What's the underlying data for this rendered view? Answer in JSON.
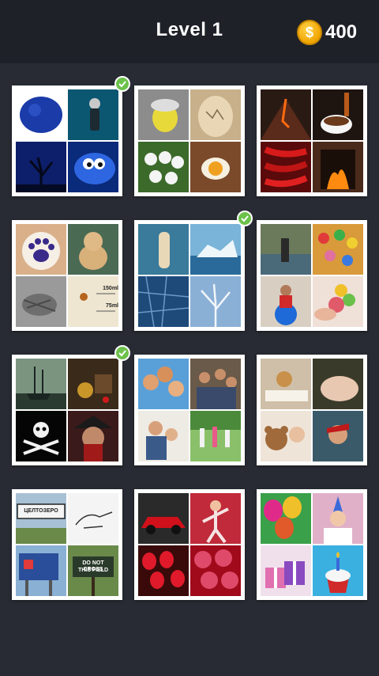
{
  "header": {
    "title": "Level 1",
    "coin_symbol": "$",
    "coin_count": "400"
  },
  "tiles": [
    {
      "name": "puzzle-blue",
      "solved": true,
      "colors": [
        "#1a3ba8",
        "#0b4c66",
        "#0d1740",
        "#2a58c9"
      ]
    },
    {
      "name": "puzzle-egg",
      "solved": false,
      "colors": [
        "#b9a27a",
        "#d9c7a3",
        "#f2e27a",
        "#8f5b3a"
      ]
    },
    {
      "name": "puzzle-hot",
      "solved": false,
      "colors": [
        "#7a2a12",
        "#3a1f14",
        "#b1161c",
        "#c9551a"
      ]
    },
    {
      "name": "puzzle-dog",
      "solved": false,
      "colors": [
        "#d8b492",
        "#5e7a63",
        "#a2a2a2",
        "#efe6d2"
      ]
    },
    {
      "name": "puzzle-ice",
      "solved": true,
      "colors": [
        "#6a8ea0",
        "#5f9cc6",
        "#234a78",
        "#9ab7d4"
      ]
    },
    {
      "name": "puzzle-ball",
      "solved": false,
      "colors": [
        "#7e8f6a",
        "#d8a84a",
        "#cfc2b2",
        "#e9a09a"
      ]
    },
    {
      "name": "puzzle-pirate",
      "solved": true,
      "colors": [
        "#5a7660",
        "#5a3e24",
        "#0a0a0a",
        "#612020"
      ]
    },
    {
      "name": "puzzle-family",
      "solved": false,
      "colors": [
        "#d69a6a",
        "#5a4a3a",
        "#e6e2dc",
        "#6a9a4a"
      ]
    },
    {
      "name": "puzzle-sleep",
      "solved": false,
      "colors": [
        "#b98a5a",
        "#e3c8ae",
        "#dcbfa0",
        "#3c5a6a"
      ]
    },
    {
      "name": "puzzle-sign",
      "solved": false,
      "colors": [
        "#cfd8e0",
        "#f2f2f2",
        "#2d4e9a",
        "#5a7a3a"
      ]
    },
    {
      "name": "puzzle-red",
      "solved": false,
      "colors": [
        "#b01520",
        "#c92d3c",
        "#7a0a10",
        "#e05060"
      ]
    },
    {
      "name": "puzzle-birthday",
      "solved": false,
      "colors": [
        "#2fa24a",
        "#d2b6c8",
        "#e0a0c8",
        "#4ab0d8"
      ]
    }
  ],
  "labels": {
    "sign_text": "ЦЕЛТОЗЕРО",
    "warning_line1": "DO NOT CROSS",
    "warning_line2": "THIS FIELD",
    "measure_a": "150ml",
    "measure_b": "75ml"
  }
}
